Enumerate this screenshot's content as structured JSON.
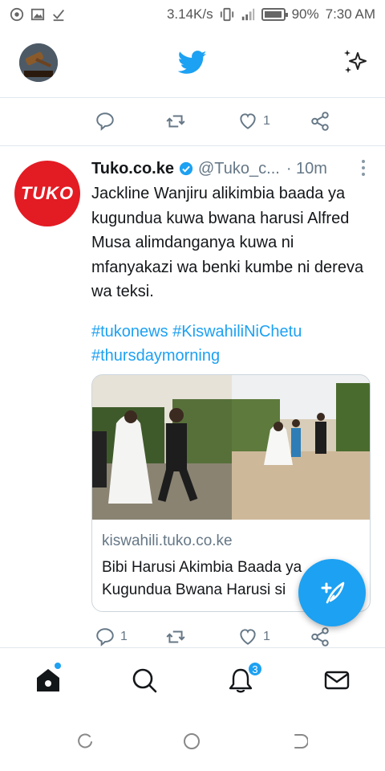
{
  "status_bar": {
    "speed": "3.14K/s",
    "battery": "90%",
    "time": "7:30 AM"
  },
  "header": {
    "logo_icon": "twitter-bird-icon",
    "right_icon": "sparkle-icon"
  },
  "prev_tweet_actions": {
    "reply_count": "",
    "retweet_count": "",
    "like_count": "1"
  },
  "tweet": {
    "name": "Tuko.co.ke",
    "handle": "@Tuko_c...",
    "time": "· 10m",
    "avatar_text": "TUKO",
    "text": "Jackline Wanjiru alikimbia baada ya kugundua kuwa bwana harusi Alfred Musa alimdanganya kuwa ni mfanyakazi wa benki kumbe ni dereva wa teksi.",
    "hashtags": "#tukonews #KiswahiliNiChetu #thursdaymorning",
    "card": {
      "domain": "kiswahili.tuko.co.ke",
      "title": "Bibi Harusi Akimbia Baada ya Kugundua Bwana Harusi si"
    },
    "actions": {
      "reply_count": "1",
      "retweet_count": "",
      "like_count": "1"
    }
  },
  "bottom_nav": {
    "notifications_badge": "3"
  },
  "colors": {
    "accent": "#1da1f2",
    "brand_red": "#e31b23"
  }
}
